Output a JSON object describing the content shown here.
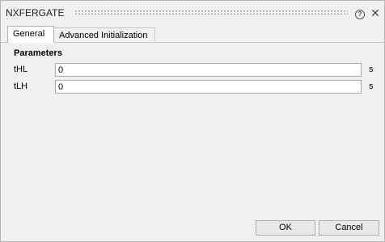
{
  "window": {
    "title": "NXFERGATE"
  },
  "tabs": [
    {
      "label": "General",
      "active": true
    },
    {
      "label": "Advanced Initialization",
      "active": false
    }
  ],
  "parameters": {
    "section_title": "Parameters",
    "rows": [
      {
        "label": "tHL",
        "value": "0",
        "unit": "s"
      },
      {
        "label": "tLH",
        "value": "0",
        "unit": "s"
      }
    ]
  },
  "footer": {
    "ok_label": "OK",
    "cancel_label": "Cancel"
  },
  "icons": {
    "help": "help-icon",
    "close": "close-icon"
  }
}
